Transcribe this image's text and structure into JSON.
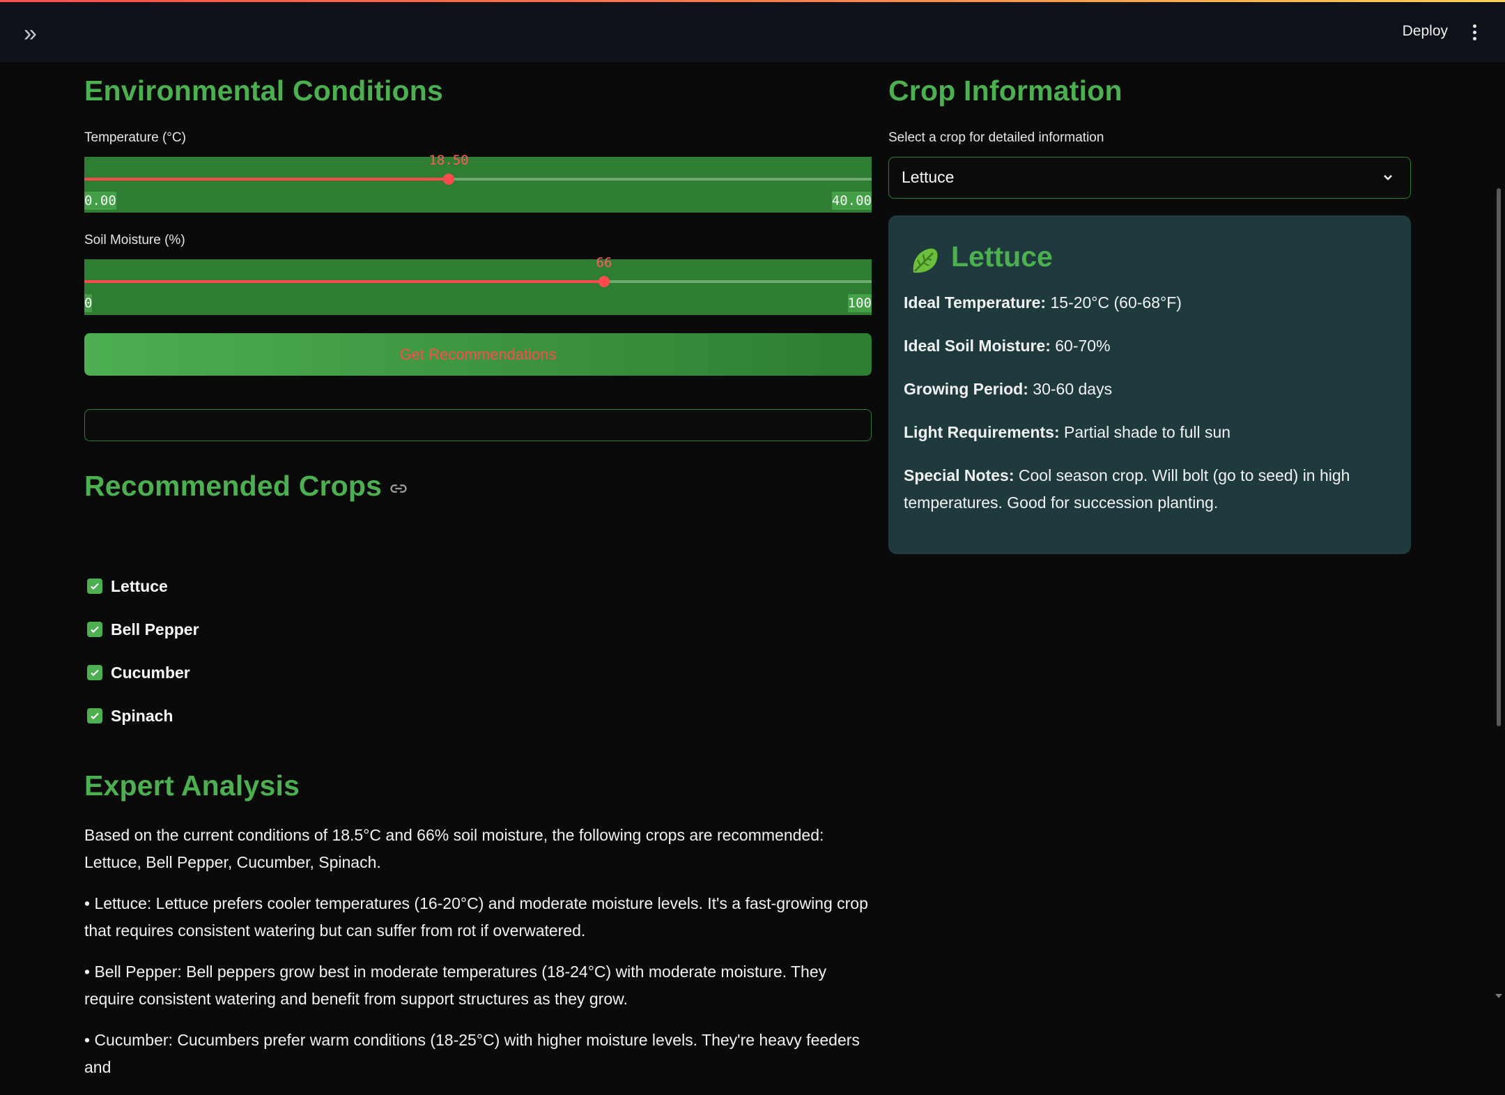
{
  "header": {
    "deploy_label": "Deploy"
  },
  "environment": {
    "title": "Environmental Conditions",
    "temperature": {
      "label": "Temperature (°C)",
      "value": "18.50",
      "min": "0.00",
      "max": "40.00",
      "fraction": 0.4625
    },
    "moisture": {
      "label": "Soil Moisture (%)",
      "value": "66",
      "min": "0",
      "max": "100",
      "fraction": 0.66
    },
    "button_label": "Get Recommendations"
  },
  "recommended": {
    "title": "Recommended Crops",
    "items": [
      "Lettuce",
      "Bell Pepper",
      "Cucumber",
      "Spinach"
    ]
  },
  "analysis": {
    "title": "Expert Analysis",
    "paragraphs": [
      "Based on the current conditions of 18.5°C and 66% soil moisture, the following crops are recommended: Lettuce, Bell Pepper, Cucumber, Spinach.",
      "• Lettuce: Lettuce prefers cooler temperatures (16-20°C) and moderate moisture levels. It's a fast-growing crop that requires consistent watering but can suffer from rot if overwatered.",
      "• Bell Pepper: Bell peppers grow best in moderate temperatures (18-24°C) with moderate moisture. They require consistent watering and benefit from support structures as they grow.",
      "• Cucumber: Cucumbers prefer warm conditions (18-25°C) with higher moisture levels. They're heavy feeders and"
    ]
  },
  "crop_info": {
    "title": "Crop Information",
    "select_label": "Select a crop for detailed information",
    "selected": "Lettuce",
    "card": {
      "name": "Lettuce",
      "temp_label": "Ideal Temperature:",
      "temp_value": " 15-20°C (60-68°F)",
      "moist_label": "Ideal Soil Moisture:",
      "moist_value": " 60-70%",
      "period_label": "Growing Period:",
      "period_value": " 30-60 days",
      "light_label": "Light Requirements:",
      "light_value": " Partial shade to full sun",
      "notes_label": "Special Notes:",
      "notes_value": " Cool season crop. Will bolt (go to seed) in high temperatures. Good for succession planting."
    }
  },
  "colors": {
    "accent": "#4caf50",
    "slider_bg": "#2e7d32",
    "slider_thumb": "#ff4b4b",
    "card_bg": "#1f3a3d"
  }
}
